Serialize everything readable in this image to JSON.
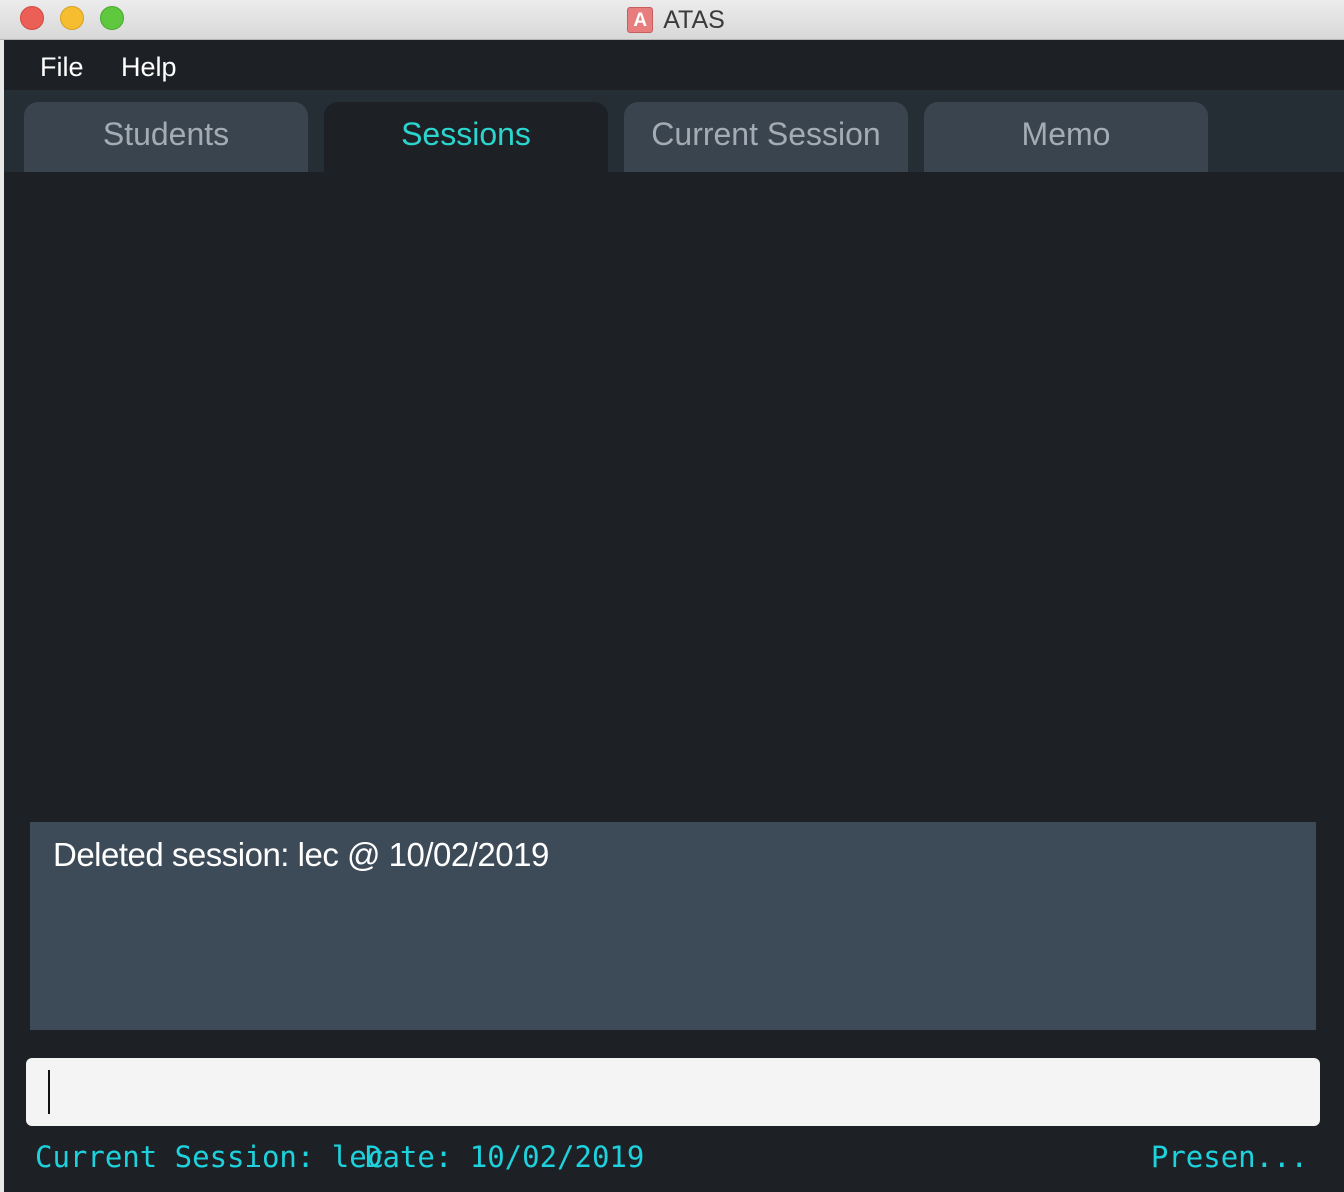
{
  "window": {
    "title": "ATAS",
    "app_icon_letter": "A"
  },
  "menu": {
    "items": [
      {
        "label": "File"
      },
      {
        "label": "Help"
      }
    ]
  },
  "tabs": [
    {
      "label": "Students",
      "active": false
    },
    {
      "label": "Sessions",
      "active": true
    },
    {
      "label": "Current Session",
      "active": false
    },
    {
      "label": "Memo",
      "active": false
    }
  ],
  "result": {
    "text": "Deleted session: lec @ 10/02/2019"
  },
  "command": {
    "value": "",
    "placeholder": ""
  },
  "status": {
    "session": "Current Session: lec",
    "date": "Date: 10/02/2019",
    "presence": "Presen..."
  },
  "colors": {
    "background": "#1d2126",
    "tab_inactive": "#3a444f",
    "tab_active_text": "#2bd4cd",
    "result_bg": "#3d4b59",
    "status_text": "#1ed2dd"
  }
}
